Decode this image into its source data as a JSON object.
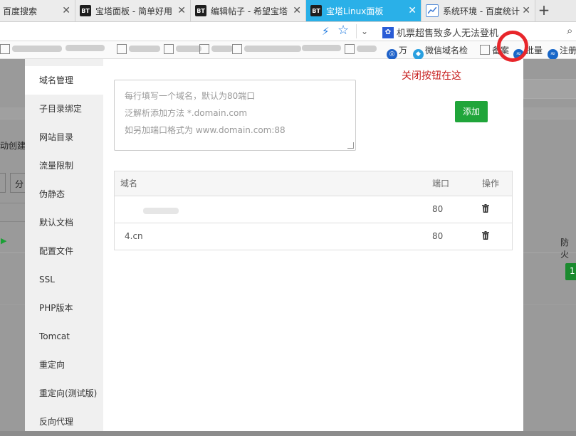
{
  "tabs": [
    {
      "title": "百度搜索",
      "favicon": "none"
    },
    {
      "title": "宝塔面板 - 简单好用",
      "favicon": "BT"
    },
    {
      "title": "编辑帖子 - 希望宝塔",
      "favicon": "BT"
    },
    {
      "title": "宝塔Linux面板",
      "favicon": "BT",
      "active": true
    },
    {
      "title": "系统环境 - 百度统计",
      "favicon": "chart-icon"
    }
  ],
  "address_bar": {
    "news_text": "机票超售致多人无法登机"
  },
  "bookmarks": {
    "item1": "万",
    "item2": "微信域名检",
    "item3": "备案",
    "item4": "批量",
    "item5": "注册"
  },
  "annotation": {
    "text": "关闭按钮在这"
  },
  "sidebar": {
    "items": [
      {
        "label": "域名管理"
      },
      {
        "label": "子目录绑定"
      },
      {
        "label": "网站目录"
      },
      {
        "label": "流量限制"
      },
      {
        "label": "伪静态"
      },
      {
        "label": "默认文档"
      },
      {
        "label": "配置文件"
      },
      {
        "label": "SSL"
      },
      {
        "label": "PHP版本"
      },
      {
        "label": "Tomcat"
      },
      {
        "label": "重定向"
      },
      {
        "label": "重定向(测试版)"
      },
      {
        "label": "反向代理"
      }
    ]
  },
  "domain_form": {
    "placeholder_line1": "每行填写一个域名，默认为80端口",
    "placeholder_line2": "泛解析添加方法 *.domain.com",
    "placeholder_line3": "如另加端口格式为 www.domain.com:88",
    "add_button": "添加"
  },
  "domain_table": {
    "headers": {
      "domain": "域名",
      "port": "端口",
      "action": "操作"
    },
    "rows": [
      {
        "domain": "",
        "port": "80"
      },
      {
        "domain": "4.cn",
        "port": "80"
      }
    ]
  },
  "background_page": {
    "left_fragment1": "动创建",
    "left_fragment2": "分",
    "right_fragment1": "防火",
    "right_fragment2": "1"
  },
  "colors": {
    "active_tab": "#2ab0e8",
    "primary_green": "#20a53a",
    "annotation_red": "#c61e1e"
  }
}
